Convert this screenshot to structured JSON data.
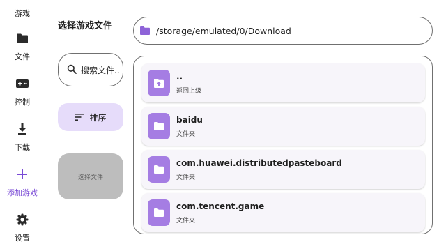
{
  "nav": {
    "items": [
      {
        "label": "游戏",
        "icon": "gamepad-icon",
        "active": false
      },
      {
        "label": "文件",
        "icon": "folder-icon",
        "active": false
      },
      {
        "label": "控制",
        "icon": "controller-icon",
        "active": false
      },
      {
        "label": "下载",
        "icon": "download-icon",
        "active": false
      },
      {
        "label": "添加游戏",
        "icon": "plus-icon",
        "active": true
      },
      {
        "label": "设置",
        "icon": "gear-icon",
        "active": false
      }
    ]
  },
  "page": {
    "title": "选择游戏文件"
  },
  "path_bar": {
    "path": "/storage/emulated/0/Download",
    "icon": "folder-icon"
  },
  "actions": {
    "search_label": "搜索文件..",
    "sort_label": "排序",
    "select_file_label": "选择文件"
  },
  "files": [
    {
      "name": "..",
      "subtitle": "返回上级",
      "icon": "folder-up-icon"
    },
    {
      "name": "baidu",
      "subtitle": "文件夹",
      "icon": "folder-icon"
    },
    {
      "name": "com.huawei.distributedpasteboard",
      "subtitle": "文件夹",
      "icon": "folder-icon"
    },
    {
      "name": "com.tencent.game",
      "subtitle": "文件夹",
      "icon": "folder-icon"
    }
  ],
  "colors": {
    "accent": "#7a4bd6",
    "folder_tile": "#a57de3",
    "sort_button_bg": "#e6dcfa",
    "select_button_bg": "#bdbdbd"
  }
}
